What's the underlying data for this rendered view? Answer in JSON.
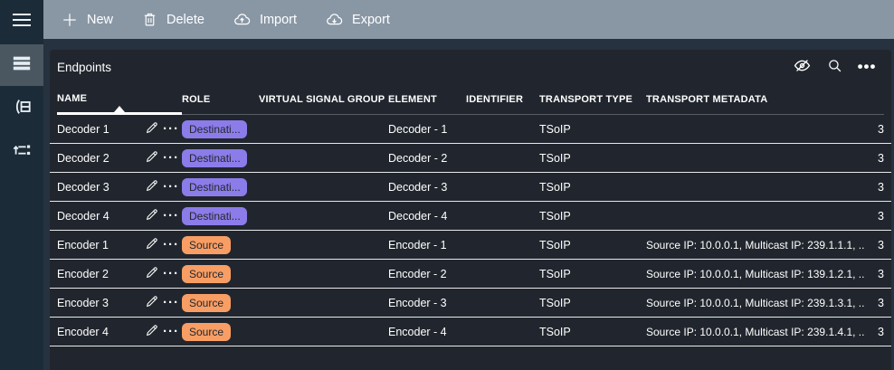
{
  "toolbar": {
    "new_label": "New",
    "delete_label": "Delete",
    "import_label": "Import",
    "export_label": "Export"
  },
  "panel": {
    "title": "Endpoints"
  },
  "icons": {
    "more_horizontal": "•••",
    "row_more": "···"
  },
  "table": {
    "columns": {
      "name": "NAME",
      "role": "ROLE",
      "virtual_signal_group": "VIRTUAL SIGNAL GROUP",
      "element": "ELEMENT",
      "identifier": "IDENTIFIER",
      "transport_type": "TRANSPORT TYPE",
      "transport_metadata": "TRANSPORT METADATA"
    },
    "sort": {
      "column": "NAME",
      "direction": "asc"
    },
    "rows": [
      {
        "name": "Decoder 1",
        "role": "Destinati...",
        "role_type": "destination",
        "virtual_signal_group": "",
        "element": "Decoder - 1",
        "identifier": "",
        "transport_type": "TSoIP",
        "transport_metadata": "",
        "count": "3"
      },
      {
        "name": "Decoder 2",
        "role": "Destinati...",
        "role_type": "destination",
        "virtual_signal_group": "",
        "element": "Decoder - 2",
        "identifier": "",
        "transport_type": "TSoIP",
        "transport_metadata": "",
        "count": "3"
      },
      {
        "name": "Decoder 3",
        "role": "Destinati...",
        "role_type": "destination",
        "virtual_signal_group": "",
        "element": "Decoder - 3",
        "identifier": "",
        "transport_type": "TSoIP",
        "transport_metadata": "",
        "count": "3"
      },
      {
        "name": "Decoder 4",
        "role": "Destinati...",
        "role_type": "destination",
        "virtual_signal_group": "",
        "element": "Decoder - 4",
        "identifier": "",
        "transport_type": "TSoIP",
        "transport_metadata": "",
        "count": "3"
      },
      {
        "name": "Encoder 1",
        "role": "Source",
        "role_type": "source",
        "virtual_signal_group": "",
        "element": "Encoder - 1",
        "identifier": "",
        "transport_type": "TSoIP",
        "transport_metadata": "Source IP: 10.0.0.1, Multicast IP: 239.1.1.1, ...",
        "count": "3"
      },
      {
        "name": "Encoder 2",
        "role": "Source",
        "role_type": "source",
        "virtual_signal_group": "",
        "element": "Encoder - 2",
        "identifier": "",
        "transport_type": "TSoIP",
        "transport_metadata": "Source IP: 10.0.0.1, Multicast IP: 139.1.2.1, ...",
        "count": "3"
      },
      {
        "name": "Encoder 3",
        "role": "Source",
        "role_type": "source",
        "virtual_signal_group": "",
        "element": "Encoder - 3",
        "identifier": "",
        "transport_type": "TSoIP",
        "transport_metadata": "Source IP: 10.0.0.1, Multicast IP: 239.1.3.1, ...",
        "count": "3"
      },
      {
        "name": "Encoder 4",
        "role": "Source",
        "role_type": "source",
        "virtual_signal_group": "",
        "element": "Encoder - 4",
        "identifier": "",
        "transport_type": "TSoIP",
        "transport_metadata": "Source IP: 10.0.0.1, Multicast IP: 239.1.4.1, ...",
        "count": "3"
      }
    ]
  },
  "colors": {
    "role_destination": "#8b7ce9",
    "role_source": "#f89e64",
    "toolbar_bg": "#8997a5",
    "sidebar_bg": "#1c2b38",
    "panel_bg": "#21262e"
  }
}
